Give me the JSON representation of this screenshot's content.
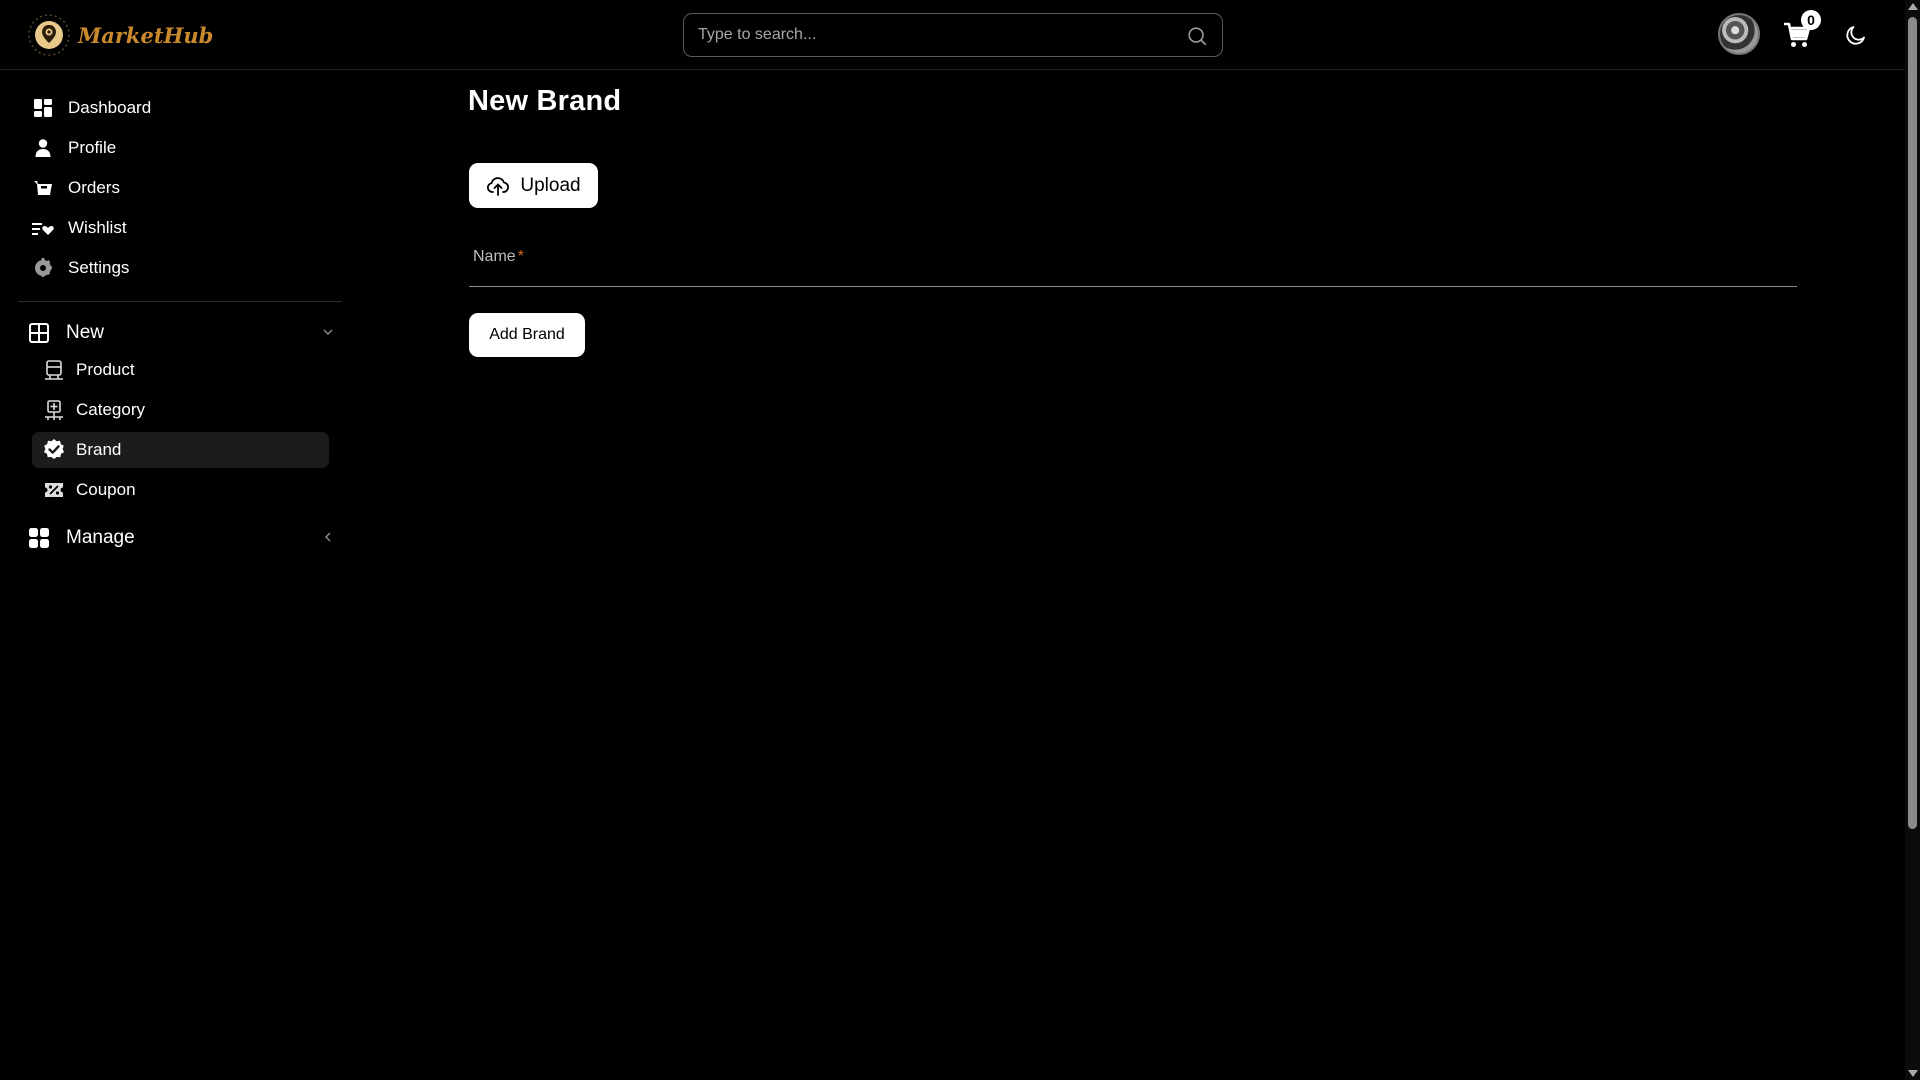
{
  "header": {
    "app_name": "MarketHub",
    "search_placeholder": "Type to search...",
    "cart_count": "0"
  },
  "sidebar": {
    "items": [
      {
        "label": "Dashboard",
        "icon": "dashboard-icon"
      },
      {
        "label": "Profile",
        "icon": "user-icon"
      },
      {
        "label": "Orders",
        "icon": "basket-icon"
      },
      {
        "label": "Wishlist",
        "icon": "wishlist-icon"
      },
      {
        "label": "Settings",
        "icon": "gear-icon"
      }
    ],
    "groups": [
      {
        "label": "New",
        "icon": "plus-square-icon",
        "expanded": true,
        "items": [
          {
            "label": "Product",
            "icon": "product-icon"
          },
          {
            "label": "Category",
            "icon": "category-icon"
          },
          {
            "label": "Brand",
            "icon": "badge-check-icon",
            "active": true
          },
          {
            "label": "Coupon",
            "icon": "coupon-icon"
          }
        ]
      },
      {
        "label": "Manage",
        "icon": "grid-icon",
        "expanded": false,
        "items": []
      }
    ]
  },
  "main": {
    "title": "New Brand",
    "upload_label": "Upload",
    "name_label": "Name",
    "required_mark": "*",
    "submit_label": "Add Brand"
  },
  "colors": {
    "background": "#000000",
    "brand": "#c98a2e",
    "required": "#d2691e",
    "active_item": "#1c1c1c"
  }
}
